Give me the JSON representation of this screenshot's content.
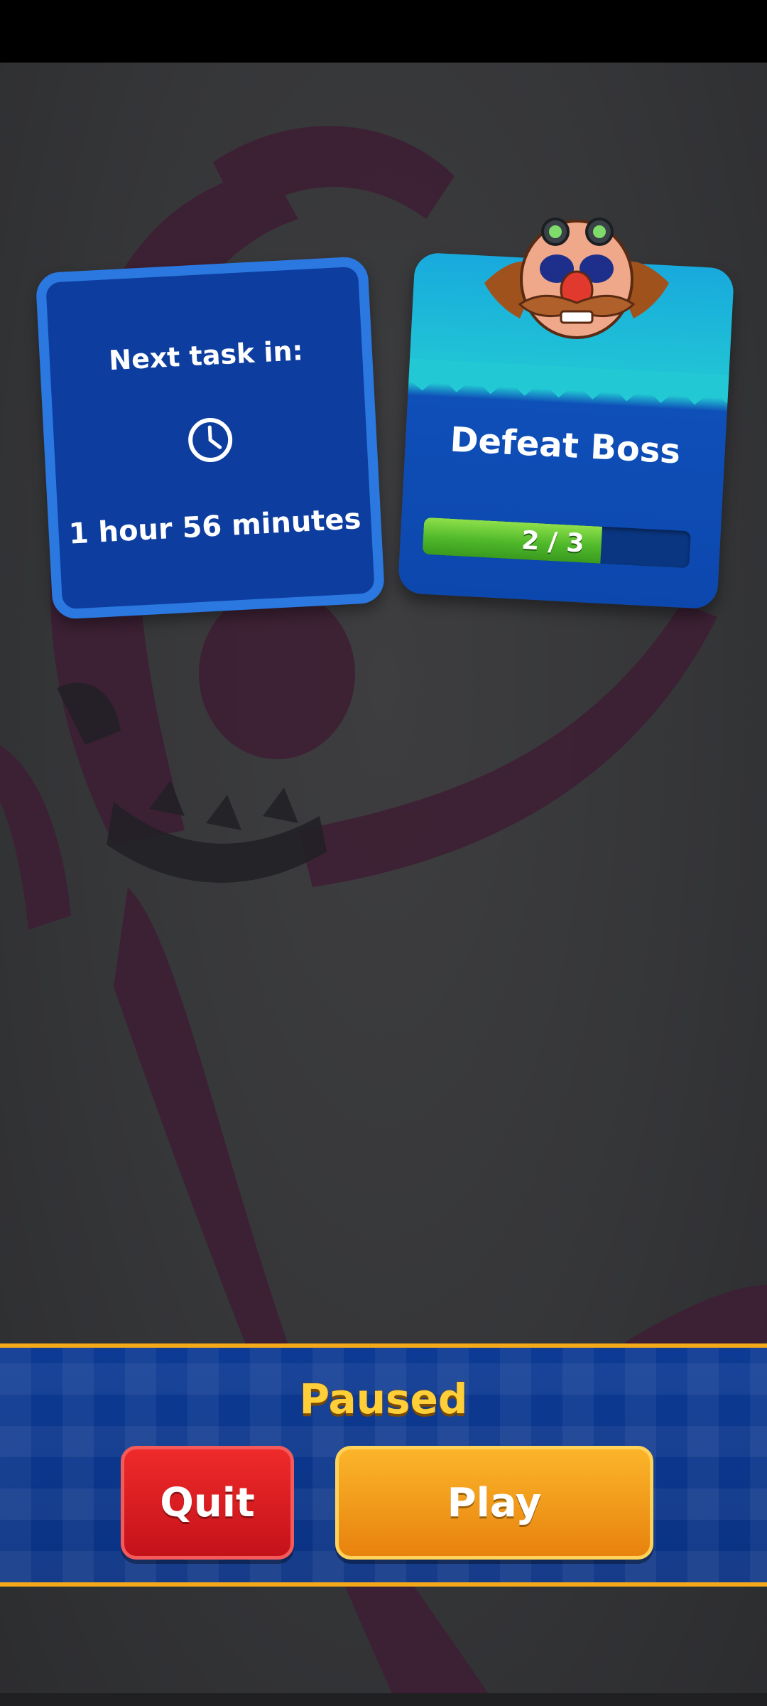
{
  "pause_menu": {
    "title": "Paused",
    "quit_label": "Quit",
    "play_label": "Play"
  },
  "next_task_card": {
    "title": "Next task in:",
    "time_remaining": "1 hour 56 minutes",
    "icon": "clock-icon"
  },
  "mission_card": {
    "name": "Defeat Boss",
    "progress_text": "2 / 3",
    "progress_current": 2,
    "progress_total": 3,
    "icon": "boss-avatar"
  },
  "colors": {
    "panel_blue": "#0d3a94",
    "accent_gold": "#f3a91a",
    "quit_red": "#d41a1f",
    "play_orange": "#f19d1c",
    "progress_green": "#4fb82a",
    "card_border": "#2a78e0"
  }
}
